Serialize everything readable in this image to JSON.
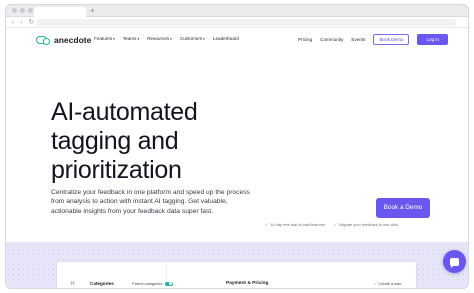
{
  "browser": {
    "new_tab": "+",
    "nav_arrows": "‹ › ↻"
  },
  "nav": {
    "logo_text": "anecdote",
    "menu": [
      {
        "label": "Features",
        "caret": "▾"
      },
      {
        "label": "Teams",
        "caret": "▾"
      },
      {
        "label": "Resources",
        "caret": "▾"
      },
      {
        "label": "Customers",
        "caret": "▾"
      },
      {
        "label": "Leaderboard",
        "caret": ""
      }
    ],
    "right_links": [
      "Pricing",
      "Community",
      "Events"
    ],
    "book_demo": "Book Demo",
    "login": "Log in"
  },
  "hero": {
    "title_lines": [
      "AI-automated",
      "tagging and",
      "prioritization"
    ],
    "description": "Centralize your feedback in one platform and speed up the process from analysis to action with instant AI tagging. Get valuable, actionable insights from your feedback data super fast.",
    "cta": "Book a Demo",
    "perks": [
      "14 day free trial of paid features",
      "Migrate your feedback in one-click"
    ],
    "perk_icon": "✓"
  },
  "preview": {
    "icon": "⌘",
    "categories": "Categories",
    "parent_categories": "Parent categories",
    "payment_title": "Payment & Pricing",
    "create_task": "Create a task",
    "task_icon": "✓"
  },
  "colors": {
    "brand": "#6a57f0",
    "logo_teal": "#27b3a0",
    "band": "#e6e6f8"
  },
  "icons": [
    "logo-mark-icon",
    "caret-down-icon",
    "check-icon",
    "chat-icon",
    "toggle-icon"
  ]
}
